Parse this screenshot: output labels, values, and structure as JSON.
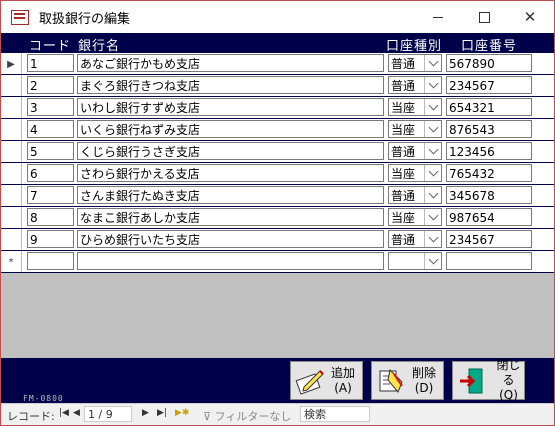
{
  "window": {
    "title": "取扱銀行の編集"
  },
  "headers": {
    "code": "コード",
    "name": "銀行名",
    "type": "口座種別",
    "number": "口座番号"
  },
  "rows": [
    {
      "code": "1",
      "name": "あなご銀行かもめ支店",
      "type": "普通",
      "number": "567890"
    },
    {
      "code": "2",
      "name": "まぐろ銀行きつね支店",
      "type": "普通",
      "number": "234567"
    },
    {
      "code": "3",
      "name": "いわし銀行すずめ支店",
      "type": "当座",
      "number": "654321"
    },
    {
      "code": "4",
      "name": "いくら銀行ねずみ支店",
      "type": "当座",
      "number": "876543"
    },
    {
      "code": "5",
      "name": "くじら銀行うさぎ支店",
      "type": "普通",
      "number": "123456"
    },
    {
      "code": "6",
      "name": "さわら銀行かえる支店",
      "type": "当座",
      "number": "765432"
    },
    {
      "code": "7",
      "name": "さんま銀行たぬき支店",
      "type": "普通",
      "number": "345678"
    },
    {
      "code": "8",
      "name": "なまこ銀行あしか支店",
      "type": "当座",
      "number": "987654"
    },
    {
      "code": "9",
      "name": "ひらめ銀行いたち支店",
      "type": "普通",
      "number": "234567"
    }
  ],
  "new_row_marker": "*",
  "current_row_marker": "▶",
  "form_id": "FM-0800",
  "buttons": {
    "add": {
      "label": "追加",
      "key": "(A)"
    },
    "delete": {
      "label": "削除",
      "key": "(D)"
    },
    "close": {
      "label": "閉じる",
      "key": "(Q)"
    }
  },
  "navbar": {
    "label": "レコード:",
    "position": "1 / 9",
    "filter": "フィルターなし",
    "search": "検索"
  }
}
